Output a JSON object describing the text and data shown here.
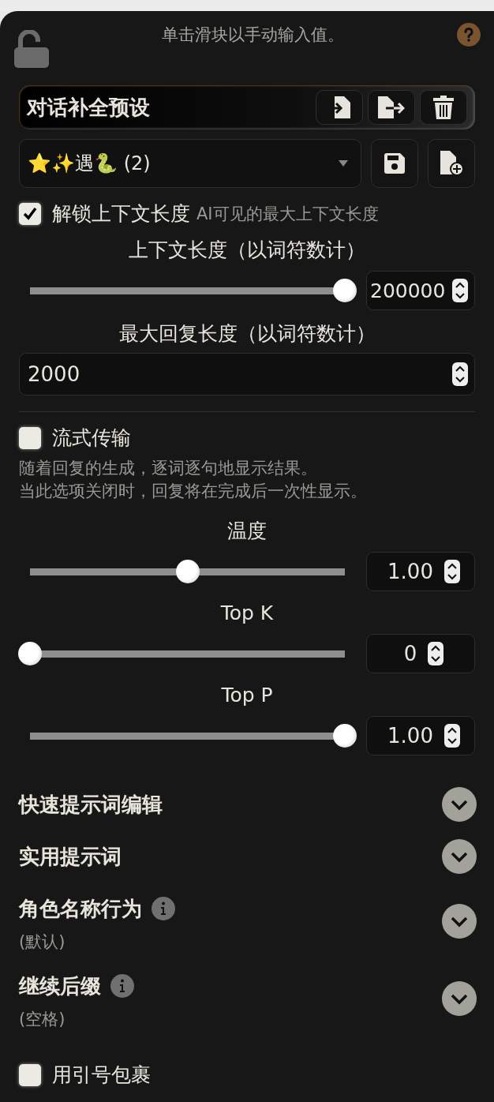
{
  "hint": "单击滑块以手动输入值。",
  "preset": {
    "title": "对话补全预设",
    "selected_value": "⭐✨遇🐍 (2)"
  },
  "unlock_context": {
    "label": "解锁上下文长度",
    "note": "AI可见的最大上下文长度",
    "checked": true
  },
  "context_length": {
    "label": "上下文长度（以词符数计）",
    "level": 1.0,
    "value": "200000"
  },
  "max_response": {
    "label": "最大回复长度（以词符数计）",
    "value": "2000"
  },
  "streaming": {
    "label": "流式传输",
    "checked": false,
    "description": [
      "随着回复的生成，逐词逐句地显示结果。",
      "当此选项关闭时，回复将在完成后一次性显示。"
    ]
  },
  "samplers": [
    {
      "label": "温度",
      "level": 0.5,
      "value": "1.00"
    },
    {
      "label": "Top K",
      "level": 0,
      "value": "0"
    },
    {
      "label": "Top P",
      "level": 1.0,
      "value": "1.00"
    }
  ],
  "sections": [
    {
      "title": "快速提示词编辑",
      "info": false
    },
    {
      "title": "实用提示词",
      "info": false
    },
    {
      "title": "角色名称行为",
      "info": true,
      "subtitle": "(默认)"
    },
    {
      "title": "继续后缀",
      "info": true,
      "subtitle": "(空格)"
    }
  ],
  "wrap_quotes": {
    "label": "用引号包裹",
    "checked": false
  }
}
